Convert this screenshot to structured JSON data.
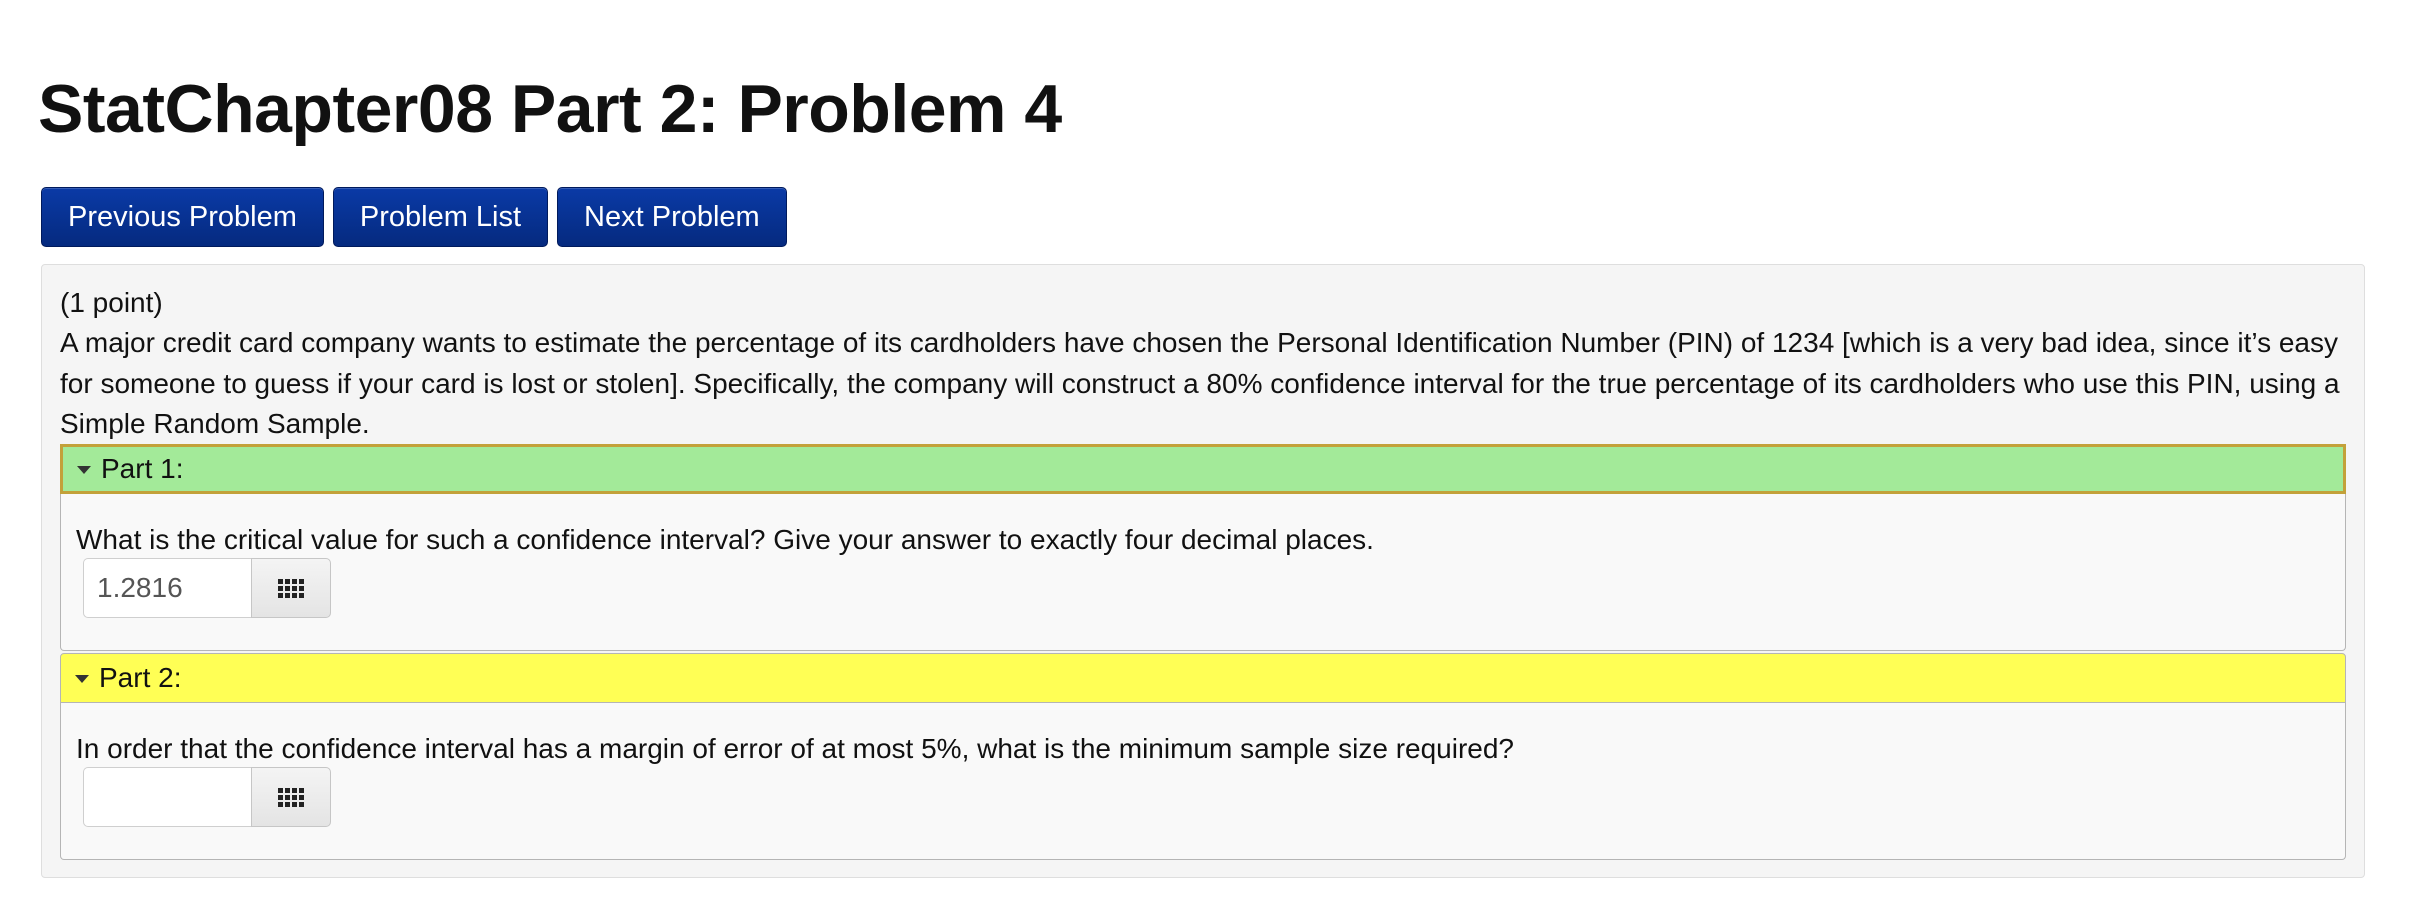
{
  "page": {
    "title": "StatChapter08 Part 2: Problem 4"
  },
  "nav": {
    "previous_label": "Previous Problem",
    "list_label": "Problem List",
    "next_label": "Next Problem",
    "button_color": "#052a7f"
  },
  "problem": {
    "points": "(1 point)",
    "statement": "A major credit card company wants to estimate the percentage of its cardholders have chosen the Personal Identification Number (PIN) of 1234 [which is a very bad idea, since it’s easy for someone to guess if your card is lost or stolen]. Specifically, the company will construct a 80% confidence interval for the true percentage of its cardholders who use this PIN, using a Simple Random Sample."
  },
  "parts": [
    {
      "header": "Part 1:",
      "question": "What is the critical value for such a confidence interval? Give your answer to exactly four decimal places.",
      "answer_value": "1.2816",
      "answer_placeholder": "",
      "header_color": "#a3ea99",
      "keypad_icon": "keypad-grid-icon"
    },
    {
      "header": "Part 2:",
      "question": "In order that the confidence interval has a margin of error of at most 5%, what is the minimum sample size required?",
      "answer_value": "",
      "answer_placeholder": "",
      "header_color": "#ffff55",
      "keypad_icon": "keypad-grid-icon"
    }
  ]
}
